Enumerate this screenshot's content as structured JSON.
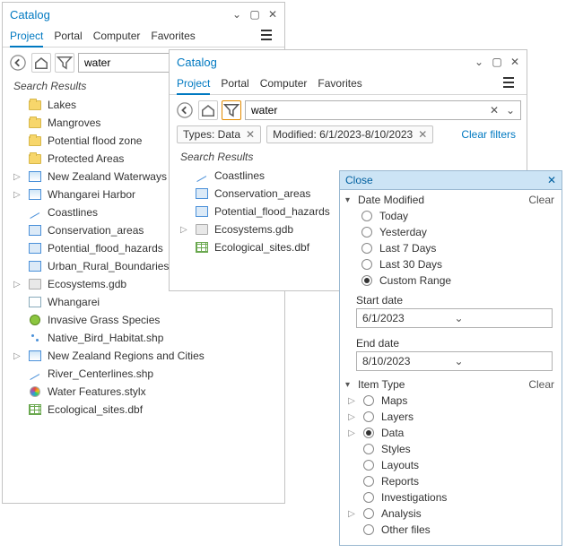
{
  "pane1": {
    "title": "Catalog",
    "tabs": [
      "Project",
      "Portal",
      "Computer",
      "Favorites"
    ],
    "activeTab": 0,
    "search": {
      "value": "water"
    },
    "searchHeading": "Search Results",
    "items": [
      {
        "icon": "folder",
        "label": "Lakes"
      },
      {
        "icon": "folder",
        "label": "Mangroves"
      },
      {
        "icon": "folder",
        "label": "Potential flood zone"
      },
      {
        "icon": "folder",
        "label": "Protected Areas"
      },
      {
        "icon": "map",
        "label": "New Zealand Waterways",
        "expandable": true
      },
      {
        "icon": "map",
        "label": "Whangarei Harbor",
        "expandable": true
      },
      {
        "icon": "line",
        "label": "Coastlines"
      },
      {
        "icon": "poly",
        "label": "Conservation_areas"
      },
      {
        "icon": "poly",
        "label": "Potential_flood_hazards"
      },
      {
        "icon": "poly",
        "label": "Urban_Rural_Boundaries"
      },
      {
        "icon": "gdb",
        "label": "Ecosystems.gdb",
        "expandable": true
      },
      {
        "icon": "layer",
        "label": "Whangarei"
      },
      {
        "icon": "bug",
        "label": "Invasive Grass Species"
      },
      {
        "icon": "point",
        "label": "Native_Bird_Habitat.shp"
      },
      {
        "icon": "map",
        "label": "New Zealand Regions and Cities",
        "expandable": true
      },
      {
        "icon": "line",
        "label": "River_Centerlines.shp"
      },
      {
        "icon": "style",
        "label": "Water Features.stylx"
      },
      {
        "icon": "table",
        "label": "Ecological_sites.dbf"
      }
    ]
  },
  "pane2": {
    "title": "Catalog",
    "tabs": [
      "Project",
      "Portal",
      "Computer",
      "Favorites"
    ],
    "activeTab": 0,
    "search": {
      "value": "water"
    },
    "chips": [
      {
        "label": "Types: Data"
      },
      {
        "label": "Modified: 6/1/2023-8/10/2023"
      }
    ],
    "clearFilters": "Clear filters",
    "searchHeading": "Search Results",
    "items": [
      {
        "icon": "line",
        "label": "Coastlines"
      },
      {
        "icon": "poly",
        "label": "Conservation_areas"
      },
      {
        "icon": "poly",
        "label": "Potential_flood_hazards"
      },
      {
        "icon": "gdb",
        "label": "Ecosystems.gdb",
        "expandable": true
      },
      {
        "icon": "table",
        "label": "Ecological_sites.dbf"
      }
    ]
  },
  "popup": {
    "headerLabel": "Close",
    "sections": {
      "dateModified": {
        "title": "Date Modified",
        "clear": "Clear",
        "options": [
          "Today",
          "Yesterday",
          "Last 7 Days",
          "Last 30 Days",
          "Custom Range"
        ],
        "selected": 4,
        "startLabel": "Start date",
        "startValue": "6/1/2023",
        "endLabel": "End date",
        "endValue": "8/10/2023"
      },
      "itemType": {
        "title": "Item Type",
        "clear": "Clear",
        "options": [
          {
            "label": "Maps",
            "expandable": true
          },
          {
            "label": "Layers",
            "expandable": true
          },
          {
            "label": "Data",
            "expandable": true,
            "selected": true
          },
          {
            "label": "Styles"
          },
          {
            "label": "Layouts"
          },
          {
            "label": "Reports"
          },
          {
            "label": "Investigations"
          },
          {
            "label": "Analysis",
            "expandable": true
          },
          {
            "label": "Other files"
          }
        ]
      }
    }
  }
}
